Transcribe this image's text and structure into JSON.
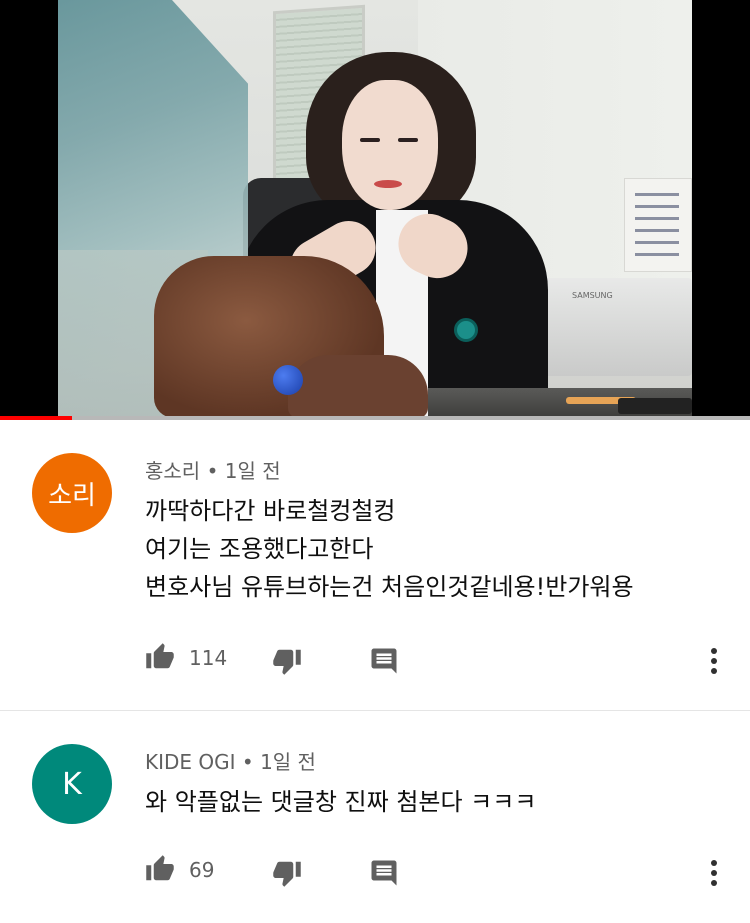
{
  "video": {
    "progress_fraction": 0.096,
    "brand_label": "SAMSUNG"
  },
  "comments": [
    {
      "avatar_text": "소리",
      "avatar_color": "#ef6c00",
      "author": "홍소리",
      "time": "1일 전",
      "lines": [
        "까딱하다간 바로철컹철컹",
        "여기는 조용했다고한다",
        "변호사님 유튜브하는건 처음인것같네용!반가워용"
      ],
      "likes": "114"
    },
    {
      "avatar_text": "K",
      "avatar_color": "#00897b",
      "author": "KIDE OGI",
      "time": "1일 전",
      "lines": [
        "와 악플없는 댓글창 진짜 첨본다 ㅋㅋㅋ"
      ],
      "likes": "69"
    }
  ],
  "icons": {
    "like": "thumb-up-icon",
    "dislike": "thumb-down-icon",
    "reply": "reply-comment-icon",
    "more": "more-vert-icon"
  },
  "colors": {
    "progress": "#ff0000",
    "secondary_text": "#606060"
  }
}
